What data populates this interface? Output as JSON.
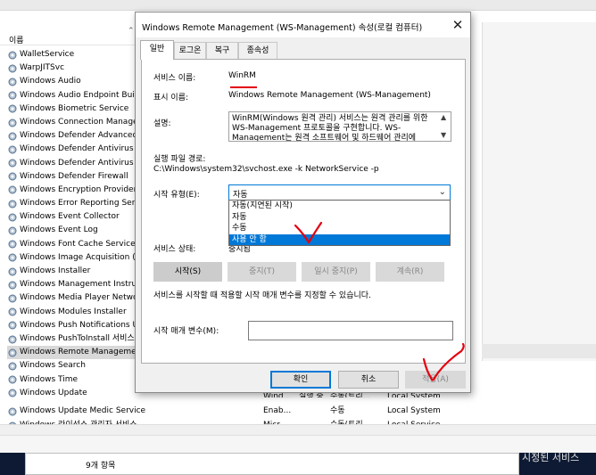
{
  "background": {
    "column_header": "이름",
    "services": [
      "WalletService",
      "WarpJITSvc",
      "Windows Audio",
      "Windows Audio Endpoint Buil",
      "Windows Biometric Service",
      "Windows Connection Manage",
      "Windows Defender Advanced",
      "Windows Defender Antivirus N",
      "Windows Defender Antivirus S",
      "Windows Defender Firewall",
      "Windows Encryption Provider",
      "Windows Error Reporting Serv",
      "Windows Event Collector",
      "Windows Event Log",
      "Windows Font Cache Service",
      "Windows Image Acquisition (V",
      "Windows Installer",
      "Windows Management Instrur",
      "Windows Media Player Netwo",
      "Windows Modules Installer",
      "Windows Push Notifications U",
      "Windows PushToInstall 서비스",
      "Windows Remote Managemen",
      "Windows Search",
      "Windows Time",
      "Windows Update"
    ],
    "selected_service_index": 22,
    "partial_under_row": [
      "Wind...",
      "실행 중",
      "수동(트리...",
      "Local System"
    ],
    "extra_rows": [
      {
        "name": "Windows Update Medic Service",
        "desc": "Enab...",
        "startup": "수동",
        "logon": "Local System"
      },
      {
        "name": "Windows 라이선스 관리자 서비스",
        "desc": "Micr...",
        "startup": "수동(트리...",
        "logon": "Local Service"
      }
    ],
    "status_text": "9개 항목",
    "taskbar_right_text": "시정된 서비스"
  },
  "dialog": {
    "title": "Windows Remote Management (WS-Management) 속성(로컬 컴퓨터)",
    "close_glyph": "✕",
    "tabs": [
      "일반",
      "로그온",
      "복구",
      "종속성"
    ],
    "active_tab": 0,
    "service_name_label": "서비스 이름:",
    "service_name_value": "WinRM",
    "display_name_label": "표시 이름:",
    "display_name_value": "Windows Remote Management (WS-Management)",
    "description_label": "설명:",
    "description_value": "WinRM(Windows 원격 관리) 서비스는 원격 관리를 위한 WS-Management 프로토콜을 구현합니다. WS-Management는 원격 소프트웨어 및 하드웨어 관리에",
    "exe_path_label": "실행 파일 경로:",
    "exe_path_value": "C:\\Windows\\system32\\svchost.exe -k NetworkService -p",
    "startup_type_label": "시작 유형(E):",
    "startup_type_value": "자동",
    "startup_options": [
      "자동(지연된 시작)",
      "자동",
      "수동",
      "사용 안 함"
    ],
    "startup_highlighted_index": 3,
    "service_status_label": "서비스 상태:",
    "service_status_value": "중지됨",
    "buttons": {
      "start": "시작(S)",
      "stop": "중지(T)",
      "pause": "일시 중지(P)",
      "resume": "계속(R)"
    },
    "hint_text": "서비스를 시작할 때 적용할 시작 매개 변수를 지정할 수 있습니다.",
    "start_params_label": "시작 매개 변수(M):",
    "start_params_value": "",
    "ok_label": "확인",
    "cancel_label": "취소",
    "apply_label": "적용(A)"
  },
  "colors": {
    "selection": "#0078d7",
    "annotation": "#e3000f",
    "taskbar": "#0e1a33"
  }
}
